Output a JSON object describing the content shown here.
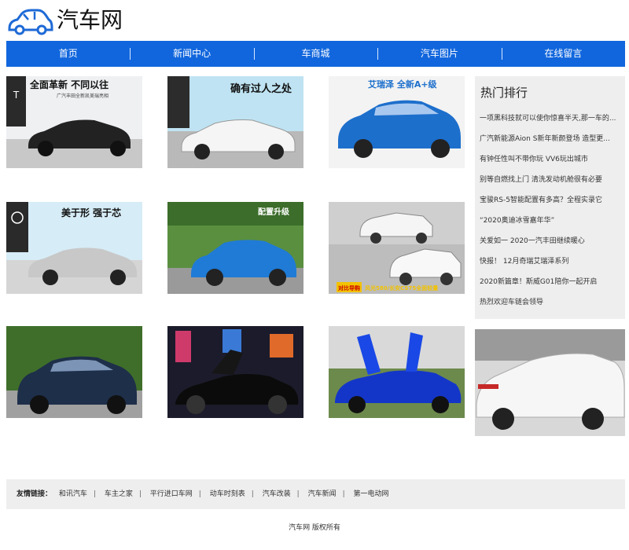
{
  "site": {
    "title": "汽车网",
    "copyright": "汽车网 版权所有"
  },
  "nav": [
    "首页",
    "新闻中心",
    "车商城",
    "汽车图片",
    "在线留言"
  ],
  "gallery": [
    {
      "banner_text": "全面革新 不同以往",
      "banner_sub": "广汽丰田全新凯美瑞亮相",
      "accent": "#e01818"
    },
    {
      "banner_text": "确有过人之处",
      "accent": "#222222"
    },
    {
      "banner_text": "艾瑞泽 全新A+级",
      "accent": "#1d6fcc"
    },
    {
      "banner_text": "美于形 强于芯",
      "accent": "#222222"
    },
    {
      "banner_text": "配置升级",
      "accent": "#1d6fcc"
    },
    {
      "banner_text": "风光580/长安CS75全面较量",
      "badge": "对比导购",
      "accent": "#f2c200"
    },
    {
      "accent": "#1e2f4a"
    },
    {
      "accent": "#1a1a1a"
    },
    {
      "accent": "#1436c8"
    }
  ],
  "sidebar": {
    "title": "热门排行",
    "items": [
      "一项黑科技就可以使你惊喜半天,那一车的...",
      "广汽新能源Aion S新年新颜登场 造型更...",
      "有钟任性叫不带你玩 VV6玩出城市",
      "别等自燃找上门 清洗发动机舱很有必要",
      "宝骏RS-5智能配置有多高？全程实录它",
      "“2020奥迪冰雪嘉年华”",
      "关爱如一 2020一汽丰田继续暖心",
      "快报！ 12月奇瑞艾瑞泽系列",
      "2020新篇章！斯威G01陪你一起开启",
      "热烈欢迎车链会领导"
    ]
  },
  "links": {
    "label": "友情链接：",
    "items": [
      "和讯汽车",
      "车主之家",
      "平行进口车网",
      "动车时刻表",
      "汽车改装",
      "汽车新闻",
      "第一电动网"
    ]
  },
  "colors": {
    "nav_bg": "#1166dd",
    "panel_bg": "#eeeeee"
  }
}
